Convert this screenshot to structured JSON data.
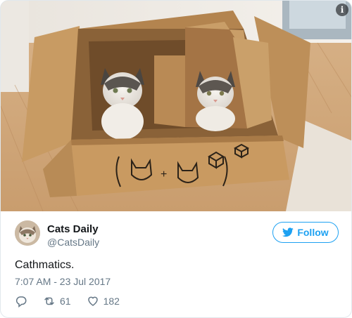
{
  "tweet": {
    "author": {
      "display_name": "Cats Daily",
      "handle": "@CatsDaily"
    },
    "follow_label": "Follow",
    "text": "Cathmatics.",
    "timestamp": "7:07 AM - 23 Jul 2017",
    "retweet_count": "61",
    "like_count": "182"
  },
  "media": {
    "info_badge": "i",
    "box_doodle": {
      "plus": "+"
    }
  },
  "icons": {
    "reply": "reply-icon",
    "retweet": "retweet-icon",
    "like": "heart-icon",
    "follow": "twitter-bird-icon",
    "info": "info-icon"
  },
  "colors": {
    "accent": "#1da1f2",
    "secondary_text": "#657786",
    "primary_text": "#14171a",
    "border": "#e1e8ed"
  }
}
